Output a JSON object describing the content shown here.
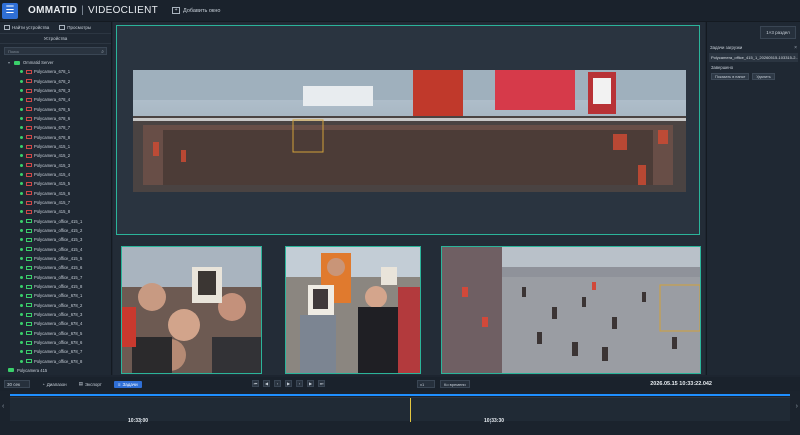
{
  "header": {
    "brand_left": "OMMATID",
    "brand_sep": "|",
    "brand_right": "VIDEOCLIENT",
    "add_window": "Добавить окно",
    "find_devices": "Найти устройства",
    "views": "Просмотры",
    "layout_select": "1×3 раздел"
  },
  "devices": {
    "title": "Устройства",
    "search_placeholder": "Поиск",
    "server": "Ommatid Server",
    "cameras": [
      {
        "label": "Polycamera_678_1",
        "status": "red"
      },
      {
        "label": "Polycamera_678_2",
        "status": "red"
      },
      {
        "label": "Polycamera_678_3",
        "status": "red"
      },
      {
        "label": "Polycamera_678_4",
        "status": "red"
      },
      {
        "label": "Polycamera_678_5",
        "status": "red"
      },
      {
        "label": "Polycamera_678_6",
        "status": "red"
      },
      {
        "label": "Polycamera_678_7",
        "status": "red"
      },
      {
        "label": "Polycamera_678_8",
        "status": "red"
      },
      {
        "label": "Polycamera_415_1",
        "status": "red"
      },
      {
        "label": "Polycamera_415_2",
        "status": "red"
      },
      {
        "label": "Polycamera_415_3",
        "status": "red"
      },
      {
        "label": "Polycamera_415_4",
        "status": "red"
      },
      {
        "label": "Polycamera_415_5",
        "status": "red"
      },
      {
        "label": "Polycamera_415_6",
        "status": "red"
      },
      {
        "label": "Polycamera_415_7",
        "status": "red"
      },
      {
        "label": "Polycamera_415_8",
        "status": "red"
      },
      {
        "label": "Polycamera_office_415_1",
        "status": "green"
      },
      {
        "label": "Polycamera_office_415_2",
        "status": "green"
      },
      {
        "label": "Polycamera_office_415_3",
        "status": "green"
      },
      {
        "label": "Polycamera_office_415_4",
        "status": "green"
      },
      {
        "label": "Polycamera_office_415_5",
        "status": "green"
      },
      {
        "label": "Polycamera_office_415_6",
        "status": "green"
      },
      {
        "label": "Polycamera_office_415_7",
        "status": "green"
      },
      {
        "label": "Polycamera_office_415_8",
        "status": "green"
      },
      {
        "label": "Polycamera_office_678_1",
        "status": "green"
      },
      {
        "label": "Polycamera_office_678_2",
        "status": "green"
      },
      {
        "label": "Polycamera_office_678_3",
        "status": "green"
      },
      {
        "label": "Polycamera_office_678_4",
        "status": "green"
      },
      {
        "label": "Polycamera_office_678_5",
        "status": "green"
      },
      {
        "label": "Polycamera_office_678_6",
        "status": "green"
      },
      {
        "label": "Polycamera_office_678_7",
        "status": "green"
      },
      {
        "label": "Polycamera_office_678_8",
        "status": "green"
      }
    ],
    "groups": [
      "Polycamera 415",
      "Polycamera 678"
    ]
  },
  "tasks": {
    "title": "Задачи загрузки",
    "close": "×",
    "file": "Polycamera_office_415_1_20260515-103315-2...",
    "status": "Завершено",
    "show_in_folder": "Показать в папке",
    "delete": "Удалить"
  },
  "controls": {
    "interval": "30 сек",
    "range": "Диапазон",
    "export": "Экспорт",
    "tasks": "Задачи",
    "speed": "x1",
    "to_time": "Ко времени",
    "datetime": "2026.05.15 10:33:22.042"
  },
  "timeline": {
    "left_time": "10:33:00",
    "right_time": "10:33:30"
  },
  "colors": {
    "accent": "#2f6fd6",
    "frame": "#2bb49a",
    "cursor": "#e3c640",
    "online": "#3ad06b",
    "offline": "#d04848"
  }
}
